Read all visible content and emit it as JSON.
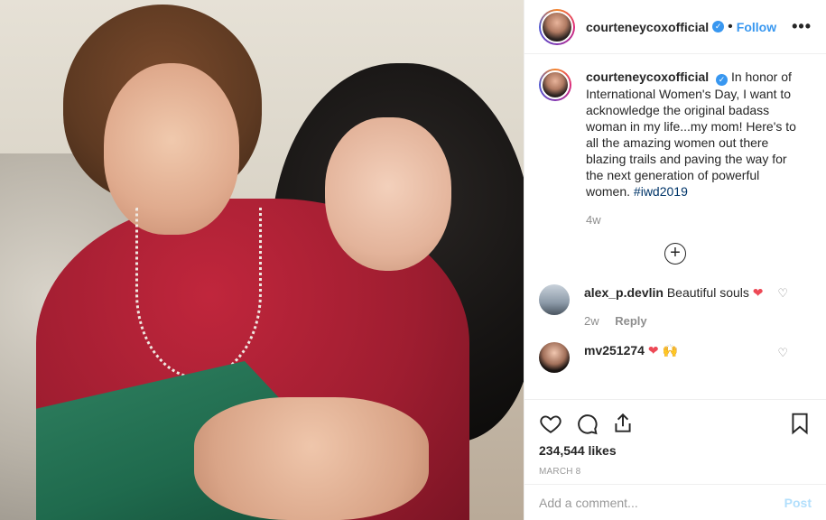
{
  "header": {
    "username": "courteneycoxofficial",
    "verified_icon": "verified-badge-icon",
    "separator": "•",
    "follow_label": "Follow",
    "more_icon": "•••"
  },
  "caption": {
    "username": "courteneycoxofficial",
    "text": "In honor of International Women's Day, I want to acknowledge the original badass woman in my life...my mom! Here's to all the amazing women out there blazing trails and paving the way for the next generation of powerful women.",
    "hashtag": "#iwd2019",
    "time": "4w"
  },
  "load_more_icon": "+",
  "comments": [
    {
      "username": "alex_p.devlin",
      "text": "Beautiful souls",
      "emoji": "❤",
      "time": "2w",
      "reply_label": "Reply"
    },
    {
      "username": "mv251274",
      "text": "",
      "emoji": "❤ 🙌",
      "time": "",
      "reply_label": ""
    }
  ],
  "likes": "234,544 likes",
  "date": "MARCH 8",
  "add_comment_placeholder": "Add a comment...",
  "post_label": "Post",
  "colors": {
    "accent": "#3897f0",
    "heart": "#ed4956"
  }
}
